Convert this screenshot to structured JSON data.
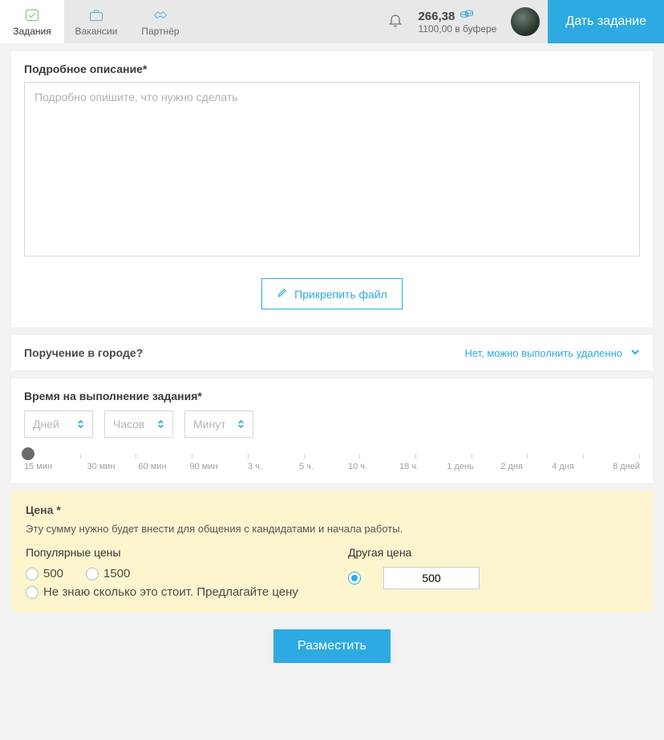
{
  "nav": {
    "tasks": "Задания",
    "vacancies": "Вакансии",
    "partner": "Партнёр"
  },
  "balance": {
    "amount": "266,38",
    "buffer": "1100,00 в буфере"
  },
  "cta_label": "Дать задание",
  "description": {
    "heading": "Подробное описание*",
    "placeholder": "Подробно опишите, что нужно сделать"
  },
  "attach_label": "Прикрепить файл",
  "city": {
    "question": "Поручение в городе?",
    "answer": "Нет, можно выполнить удаленно"
  },
  "time": {
    "heading": "Время на выполнение задания*",
    "days": "Дней",
    "hours": "Часов",
    "minutes": "Минут",
    "ticks": [
      "15 мин",
      "30 мин",
      "60 мин",
      "90 мин",
      "3 ч.",
      "5 ч.",
      "10 ч.",
      "18 ч.",
      "1 день",
      "2 дня",
      "4 дня",
      "8 дней"
    ]
  },
  "price": {
    "heading": "Цена *",
    "note": "Эту сумму нужно будет внести для общения с кандидатами и начала работы.",
    "popular_label": "Популярные цены",
    "other_label": "Другая цена",
    "opt500": "500",
    "opt1500": "1500",
    "opt_unknown": "Не знаю сколько это стоит. Предлагайте цену",
    "input_value": "500"
  },
  "submit_label": "Разместить"
}
